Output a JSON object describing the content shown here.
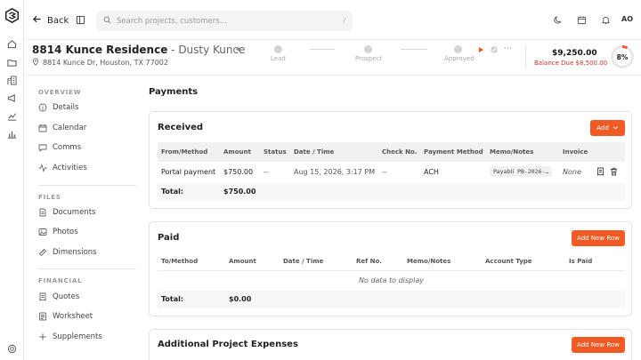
{
  "topbar": {
    "back_label": "Back",
    "search_placeholder": "Search projects, customers...",
    "search_shortcut": "/",
    "user_initials": "AO"
  },
  "project": {
    "name": "8814 Kunce Residence",
    "separator": " - ",
    "client": "Dusty Kunce",
    "address": "8814 Kunce Dr, Houston, TX 77002"
  },
  "stages": [
    {
      "label": "Lead"
    },
    {
      "label": "Prospect"
    },
    {
      "label": "Approved"
    }
  ],
  "summary": {
    "price": "$9,250.00",
    "balance": "Balance Due $8,500.00",
    "percent": "8%",
    "percent_value": 8
  },
  "nav": {
    "overview_title": "OVERVIEW",
    "overview": [
      {
        "label": "Details"
      },
      {
        "label": "Calendar"
      },
      {
        "label": "Comms"
      },
      {
        "label": "Activities"
      }
    ],
    "files_title": "FILES",
    "files": [
      {
        "label": "Documents"
      },
      {
        "label": "Photos"
      },
      {
        "label": "Dimensions"
      }
    ],
    "financial_title": "FINANCIAL",
    "financial": [
      {
        "label": "Quotes"
      },
      {
        "label": "Worksheet"
      },
      {
        "label": "Supplements"
      }
    ]
  },
  "main": {
    "title": "Payments",
    "received": {
      "title": "Received",
      "add_label": "Add",
      "columns": [
        "From/Method",
        "Amount",
        "Status",
        "Date / Time",
        "Check No.",
        "Payment Method",
        "Memo/Notes",
        "Invoice"
      ],
      "rows": [
        {
          "from": "Portal payment",
          "amount": "$750.00",
          "status": "--",
          "date": "Aug 15, 2026, 3:17 PM",
          "check": "--",
          "method": "ACH",
          "memo_prefix": "Payabli",
          "memo_code": "PB-2026-…",
          "invoice": "None"
        }
      ],
      "total_label": "Total:",
      "total_amount": "$750.00"
    },
    "paid": {
      "title": "Paid",
      "add_label": "Add New Row",
      "columns": [
        "To/Method",
        "Amount",
        "Date / Time",
        "Ref No.",
        "Memo/Notes",
        "Account Type",
        "Is Paid"
      ],
      "empty": "No data to display",
      "total_label": "Total:",
      "total_amount": "$0.00"
    },
    "expenses": {
      "title": "Additional Project Expenses",
      "add_label": "Add New Row"
    }
  },
  "colors": {
    "accent": "#f15a24",
    "danger": "#d0342c"
  }
}
